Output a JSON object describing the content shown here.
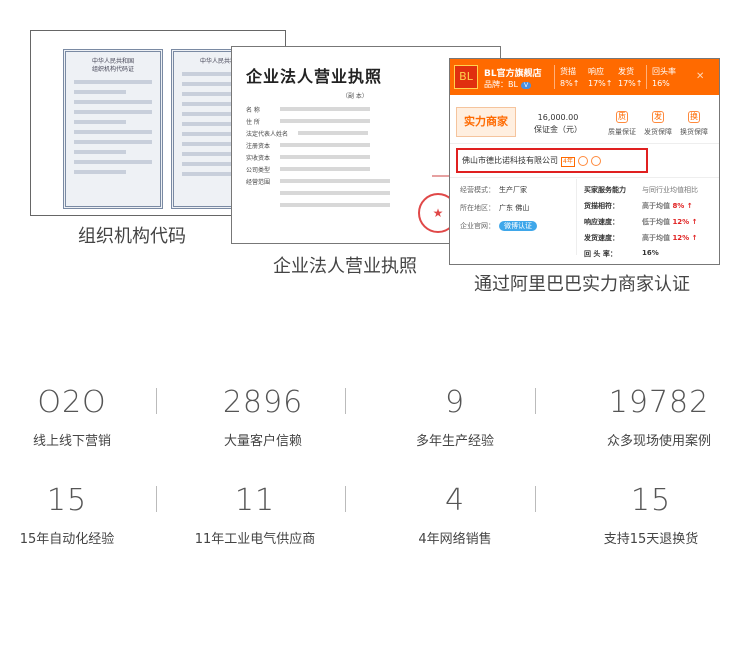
{
  "org_cert": {
    "caption": "组织机构代码",
    "heading_line1": "中华人民共和国",
    "heading_line2": "组织机构代码证"
  },
  "biz_license": {
    "caption": "企业法人营业执照",
    "title": "企业法人营业执照",
    "copy_tag": "（副  本）",
    "fields": [
      "名    称",
      "住    所",
      "法定代表人姓名",
      "注册资本",
      "实收资本",
      "公司类型",
      "经营范围"
    ],
    "seal_symbol": "★"
  },
  "alibaba_card": {
    "caption": "通过阿里巴巴实力商家认证",
    "badge": "BL",
    "store_name": "BL官方旗舰店",
    "brand_label": "品牌：BL",
    "brand_tag": "V",
    "stats": [
      {
        "label": "货描",
        "value": "8%↑"
      },
      {
        "label": "响应",
        "value": "17%↑"
      },
      {
        "label": "发货",
        "value": "17%↑"
      },
      {
        "label": "回头率",
        "value": "16%"
      }
    ],
    "close": "✕",
    "merchant_badge": "实力商家",
    "deposit_amount": "16,000.00",
    "deposit_label": "保证金（元）",
    "services": [
      {
        "icon": "质",
        "label": "质量保证"
      },
      {
        "icon": "发",
        "label": "发货保障"
      },
      {
        "icon": "换",
        "label": "换货保障"
      }
    ],
    "company_name": "佛山市德比诺科技有限公司",
    "years": "4年",
    "info": [
      {
        "label": "经营模式：",
        "value": "生产厂家"
      },
      {
        "label": "所在地区：",
        "value": "广东 佛山"
      },
      {
        "label": "企业官网：",
        "value": ""
      }
    ],
    "weibo": "微博认证",
    "metrics_header": {
      "label": "买家服务能力",
      "value": "与同行业均值相比"
    },
    "metrics": [
      {
        "label": "货描相符：",
        "value": "高于均值 ",
        "pct": "8% ↑"
      },
      {
        "label": "响应速度：",
        "value": "低于均值 ",
        "pct": "12% ↑"
      },
      {
        "label": "发货速度：",
        "value": "高于均值 ",
        "pct": "12% ↑"
      },
      {
        "label": "回 头 率：",
        "value": "16%",
        "pct": ""
      }
    ]
  },
  "stats": [
    {
      "number": "O2O",
      "label": "线上线下营销"
    },
    {
      "number": "2896",
      "label": "大量客户信赖"
    },
    {
      "number": "9",
      "label": "多年生产经验"
    },
    {
      "number": "19782",
      "label": "众多现场使用案例"
    },
    {
      "number": "15",
      "label": "15年自动化经验"
    },
    {
      "number": "11",
      "label": "11年工业电气供应商"
    },
    {
      "number": "4",
      "label": "4年网络销售"
    },
    {
      "number": "15",
      "label": "支持15天退换货"
    }
  ]
}
